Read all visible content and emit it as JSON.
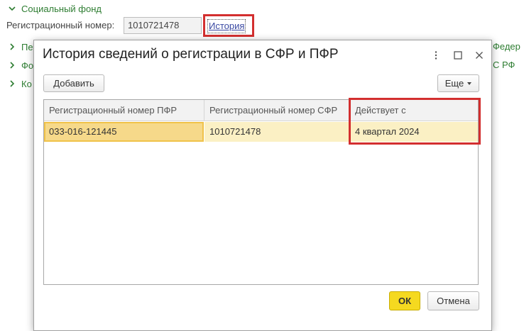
{
  "background": {
    "section_title": "Социальный фонд",
    "reg_label": "Регистрационный номер:",
    "reg_value": "1010721478",
    "history_link": "История",
    "rows": [
      {
        "label": "Пе"
      },
      {
        "label": "Фо"
      },
      {
        "label": "Ко"
      }
    ],
    "right_texts": [
      "Федер",
      "С РФ"
    ]
  },
  "dialog": {
    "title": "История сведений о регистрации в СФР и ПФР",
    "add_button": "Добавить",
    "more_button": "Еще",
    "ok_button": "ОК",
    "cancel_button": "Отмена",
    "table": {
      "columns": [
        "Регистрационный номер ПФР",
        "Регистрационный номер СФР",
        "Действует с"
      ],
      "rows": [
        [
          "033-016-121445",
          "1010721478",
          "4 квартал 2024"
        ]
      ]
    }
  },
  "colors": {
    "accent_green": "#2e7d32",
    "highlight_red": "#d32f2f",
    "selected_row": "#fbf0c4",
    "ok_button": "#f5d920"
  },
  "icons": {
    "section_toggle": "chevron-down-icon",
    "row_toggle": "chevron-right-icon",
    "menu": "kebab-menu-icon",
    "maximize": "maximize-icon",
    "close": "close-icon"
  }
}
